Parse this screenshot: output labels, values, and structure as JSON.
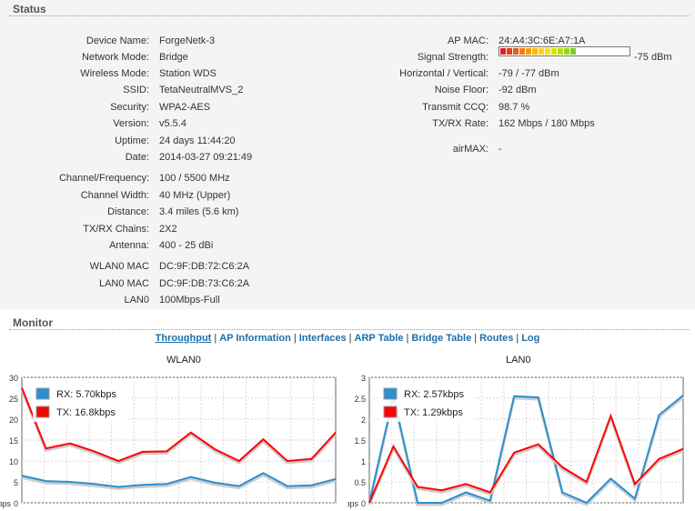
{
  "status": {
    "title": "Status",
    "left": [
      {
        "label": "Device Name:",
        "value": "ForgeNetk-3"
      },
      {
        "label": "Network Mode:",
        "value": "Bridge"
      },
      {
        "label": "Wireless Mode:",
        "value": "Station WDS"
      },
      {
        "label": "SSID:",
        "value": "TetaNeutralMVS_2"
      },
      {
        "label": "Security:",
        "value": "WPA2-AES"
      },
      {
        "label": "Version:",
        "value": "v5.5.4"
      },
      {
        "label": "Uptime:",
        "value": "24 days 11:44:20"
      },
      {
        "label": "Date:",
        "value": "2014-03-27 09:21:49"
      },
      {
        "label": "Channel/Frequency:",
        "value": "100 / 5500 MHz"
      },
      {
        "label": "Channel Width:",
        "value": "40 MHz (Upper)"
      },
      {
        "label": "Distance:",
        "value": "3.4 miles (5.6 km)"
      },
      {
        "label": "TX/RX Chains:",
        "value": "2X2"
      },
      {
        "label": "Antenna:",
        "value": "400 - 25 dBi"
      },
      {
        "label": "WLAN0 MAC",
        "value": "DC:9F:DB:72:C6:2A"
      },
      {
        "label": "LAN0 MAC",
        "value": "DC:9F:DB:73:C6:2A"
      },
      {
        "label": "LAN0",
        "value": "100Mbps-Full"
      }
    ],
    "right": [
      {
        "label": "AP MAC:",
        "value": "24:A4:3C:6E:A7:1A"
      },
      {
        "label": "Signal Strength:",
        "value": "-75 dBm"
      },
      {
        "label": "Horizontal / Vertical:",
        "value": "-79 / -77 dBm"
      },
      {
        "label": "Noise Floor:",
        "value": "-92 dBm"
      },
      {
        "label": "Transmit CCQ:",
        "value": "98.7 %"
      },
      {
        "label": "TX/RX Rate:",
        "value": "162 Mbps / 180 Mbps"
      },
      {
        "label": "airMAX:",
        "value": "-"
      }
    ],
    "signal_level_fraction": 0.69,
    "signal_colors": [
      "#e02020",
      "#e83a1a",
      "#ee5a16",
      "#f27a12",
      "#f59a10",
      "#f8b80e",
      "#fad40e",
      "#f2e20e",
      "#d6e40e",
      "#b4de12",
      "#94d61a",
      "#7ccf22",
      "#6cc826",
      "#62c22a",
      "#58bc2c",
      "#50b62e",
      "#4ab030"
    ]
  },
  "monitor": {
    "title": "Monitor",
    "tabs": [
      "Throughput",
      "AP Information",
      "Interfaces",
      "ARP Table",
      "Bridge Table",
      "Routes",
      "Log"
    ],
    "active_tab": "Throughput",
    "separator": "|"
  },
  "chart_data": [
    {
      "type": "line",
      "title": "WLAN0",
      "ylabel": "kbps",
      "ylim": [
        0,
        30
      ],
      "yticks": [
        "30",
        "25",
        "20",
        "15",
        "10",
        "5",
        "0"
      ],
      "x": [
        0,
        1,
        2,
        3,
        4,
        5,
        6,
        7,
        8,
        9,
        10,
        11,
        12,
        13
      ],
      "series": [
        {
          "name": "RX: 5.70kbps",
          "color": "#2b8fd0",
          "values": [
            6.5,
            5.2,
            5.0,
            4.5,
            3.8,
            4.3,
            4.5,
            6.2,
            4.8,
            4.0,
            7.1,
            4.0,
            4.2,
            5.7
          ]
        },
        {
          "name": "TX: 16.8kbps",
          "color": "#ff0000",
          "values": [
            27.5,
            13.0,
            14.2,
            12.3,
            10.0,
            12.2,
            12.3,
            16.8,
            12.8,
            10.0,
            15.2,
            10.0,
            10.5,
            16.8
          ]
        }
      ]
    },
    {
      "type": "line",
      "title": "LAN0",
      "ylabel": "kbps",
      "ylim": [
        0,
        3
      ],
      "yticks": [
        "3",
        "2.5",
        "2",
        "1.5",
        "1",
        "0.5",
        "0"
      ],
      "x": [
        0,
        1,
        2,
        3,
        4,
        5,
        6,
        7,
        8,
        9,
        10,
        11,
        12,
        13,
        14,
        15,
        16
      ],
      "series": [
        {
          "name": "RX: 2.57kbps",
          "color": "#2b8fd0",
          "values": [
            0,
            2.55,
            0,
            0,
            0.25,
            0.05,
            2.55,
            2.52,
            0.25,
            0,
            0.58,
            0.1,
            2.1,
            2.57
          ]
        },
        {
          "name": "TX: 1.29kbps",
          "color": "#ff0000",
          "values": [
            0,
            1.35,
            0.38,
            0.3,
            0.45,
            0.25,
            1.2,
            1.4,
            0.85,
            0.5,
            2.08,
            0.45,
            1.05,
            1.29
          ]
        }
      ]
    }
  ]
}
